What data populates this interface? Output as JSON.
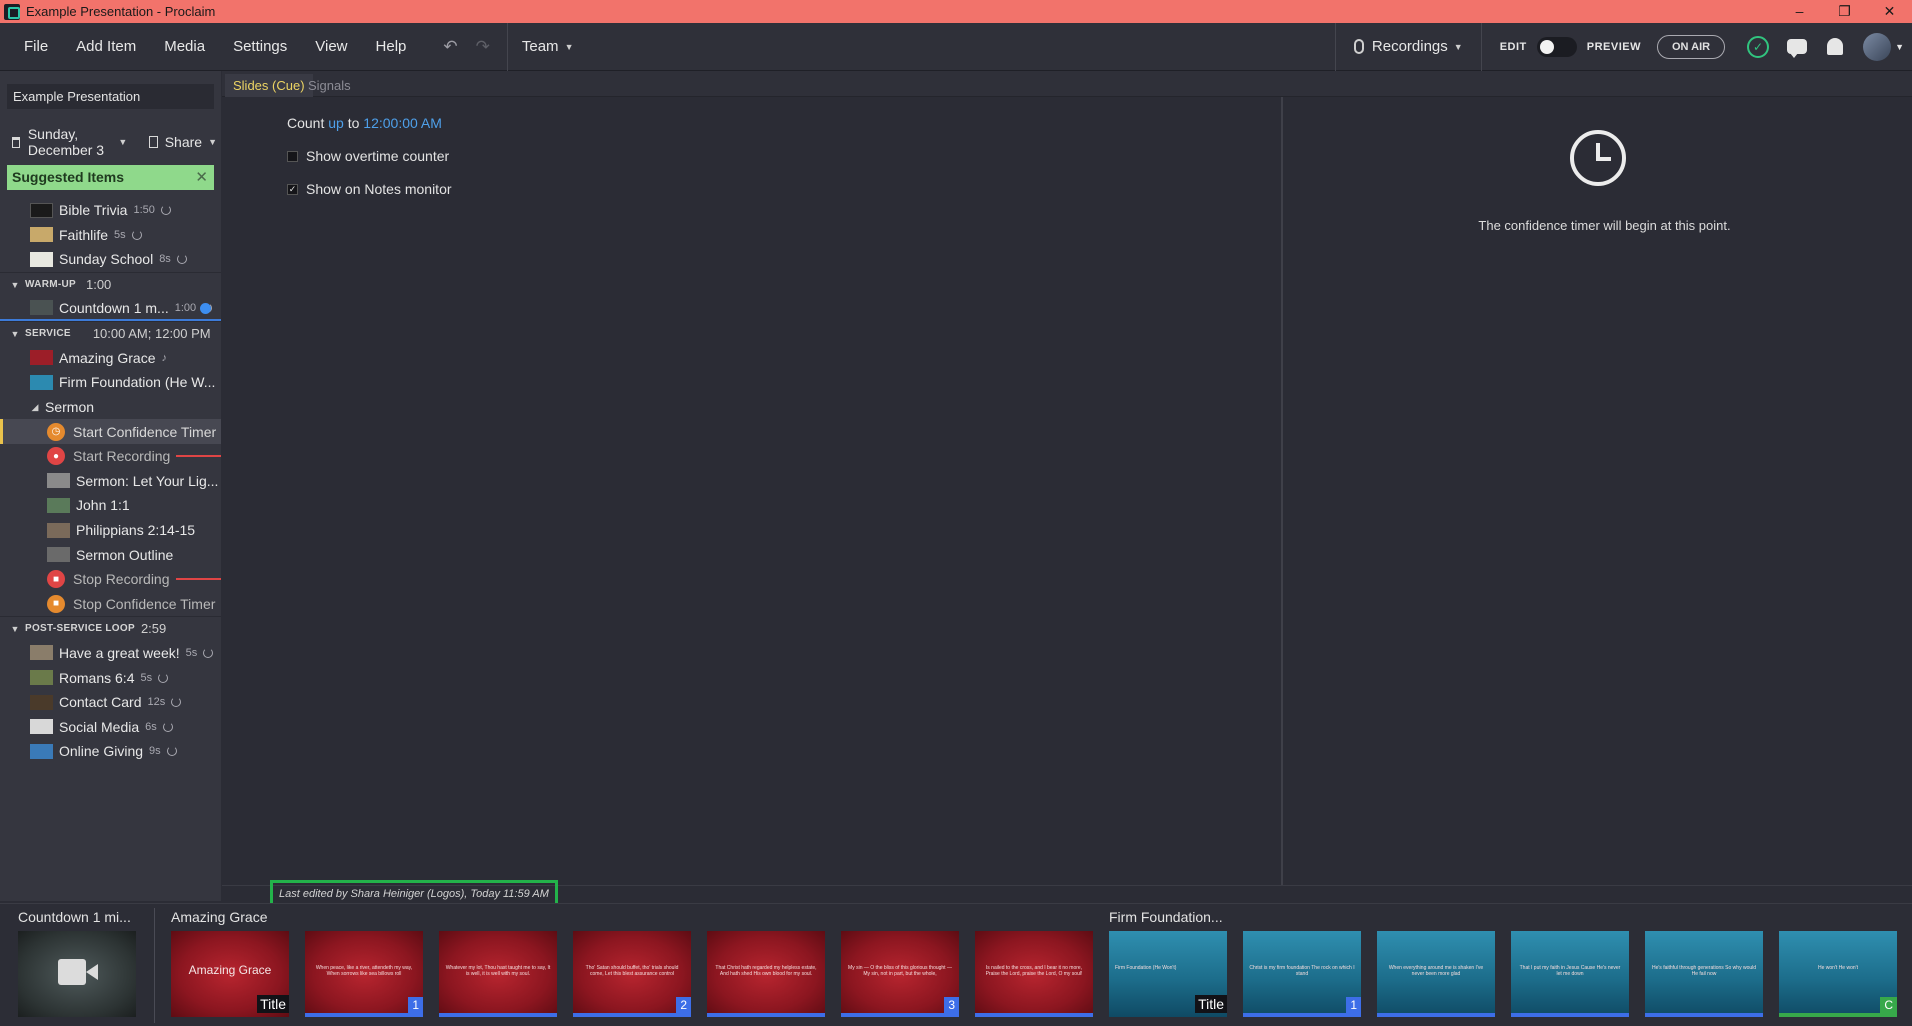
{
  "window": {
    "title": "Example Presentation - Proclaim",
    "controls": [
      "–",
      "❐",
      "✕"
    ]
  },
  "menu": [
    "File",
    "Add Item",
    "Media",
    "Settings",
    "View",
    "Help"
  ],
  "toolbar": {
    "team": "Team",
    "recordings": "Recordings",
    "edit": "EDIT",
    "preview": "PREVIEW",
    "on_air": "ON AIR"
  },
  "sidebar": {
    "presentation": "Example Presentation",
    "date": "Sunday, December 3",
    "share": "Share",
    "suggested": "Suggested Items",
    "pre": [
      {
        "label": "Bible Trivia",
        "dur": "1:50",
        "color": "#1a1a1a"
      },
      {
        "label": "Faithlife",
        "dur": "5s",
        "color": "#c8a96a"
      },
      {
        "label": "Sunday School",
        "dur": "8s",
        "color": "#e8e8e0"
      }
    ],
    "warmup": {
      "name": "WARM-UP",
      "time": "1:00",
      "item": "Countdown 1 m...",
      "dur": "1:00"
    },
    "service": {
      "name": "SERVICE",
      "time": "10:00 AM; 12:00 PM"
    },
    "service_items": [
      {
        "label": "Amazing Grace",
        "color": "#9c1e28",
        "note": "♪"
      },
      {
        "label": "Firm Foundation (He W...",
        "color": "#2c8ab0",
        "note": "·"
      }
    ],
    "sermon_group": "Sermon",
    "sermon_items": [
      {
        "label": "Start Confidence Timer",
        "kind": "cue",
        "color": "#e58a2e",
        "glyph": "◷"
      },
      {
        "label": "Start Recording",
        "kind": "cue",
        "color": "#e04545",
        "glyph": "●"
      },
      {
        "label": "Sermon: Let Your Lig...",
        "kind": "thumb",
        "color": "#8a8a8a"
      },
      {
        "label": "John 1:1",
        "kind": "thumb",
        "color": "#5a7a5a"
      },
      {
        "label": "Philippians 2:14-15",
        "kind": "thumb",
        "color": "#7a6a5a"
      },
      {
        "label": "Sermon Outline",
        "kind": "thumb",
        "color": "#6a6a6a"
      },
      {
        "label": "Stop Recording",
        "kind": "cue",
        "color": "#e04545",
        "glyph": "■"
      },
      {
        "label": "Stop Confidence Timer",
        "kind": "cue",
        "color": "#e58a2e",
        "glyph": "■"
      }
    ],
    "post": {
      "name": "POST-SERVICE LOOP",
      "time": "2:59"
    },
    "post_items": [
      {
        "label": "Have a great week!",
        "dur": "5s",
        "color": "#8a7d6a"
      },
      {
        "label": "Romans 6:4",
        "dur": "5s",
        "color": "#6a7a4a"
      },
      {
        "label": "Contact Card",
        "dur": "12s",
        "color": "#4a3a2a"
      },
      {
        "label": "Social Media",
        "dur": "6s",
        "color": "#d8d8d8"
      },
      {
        "label": "Online Giving",
        "dur": "9s",
        "color": "#3a7ab8"
      }
    ]
  },
  "tabs": {
    "active": "Slides (Cue)",
    "inactive": "Signals"
  },
  "editor": {
    "count_prefix": "Count",
    "count_dir": "up",
    "count_mid": "to",
    "count_time": "12:00:00 AM",
    "overtime": "Show overtime counter",
    "notes": "Show on Notes monitor"
  },
  "preview": {
    "text": "The confidence timer will begin at this point."
  },
  "status": {
    "last_edited": "Last edited by Shara Heiniger (Logos), Today 11:59 AM"
  },
  "strip": {
    "countdown_label": "Countdown 1 mi...",
    "amazing_label": "Amazing Grace",
    "firm_label": "Firm Foundation...",
    "title_tag": "Title",
    "amazing_title": "Amazing Grace",
    "amazing_slides": [
      "When peace, like a river, attendeth my way, When sorrows like sea billows roll",
      "Whatever my lot, Thou hast taught me to say, It is well, it is well with my soul.",
      "Tho' Satan should buffet, tho' trials should come, Let this blest assurance control",
      "That Christ hath regarded my helpless estate, And hath shed His own blood for my soul.",
      "My sin — O the bliss of this glorious thought — My sin, not in part, but the whole,",
      "Is nailed to the cross, and I bear it no more, Praise the Lord, praise the Lord, O my soul!"
    ],
    "firm_slides": [
      "Firm Foundation (He Won't)",
      "Christ is my firm foundation The rock on which I stand",
      "When everything around me is shaken I've never been more glad",
      "That I put my faith in Jesus Cause He's never let me down",
      "He's faithful through generations So why would He fail now",
      "He won't He won't"
    ],
    "tags": [
      "1",
      "2",
      "3",
      "1",
      "C"
    ]
  }
}
